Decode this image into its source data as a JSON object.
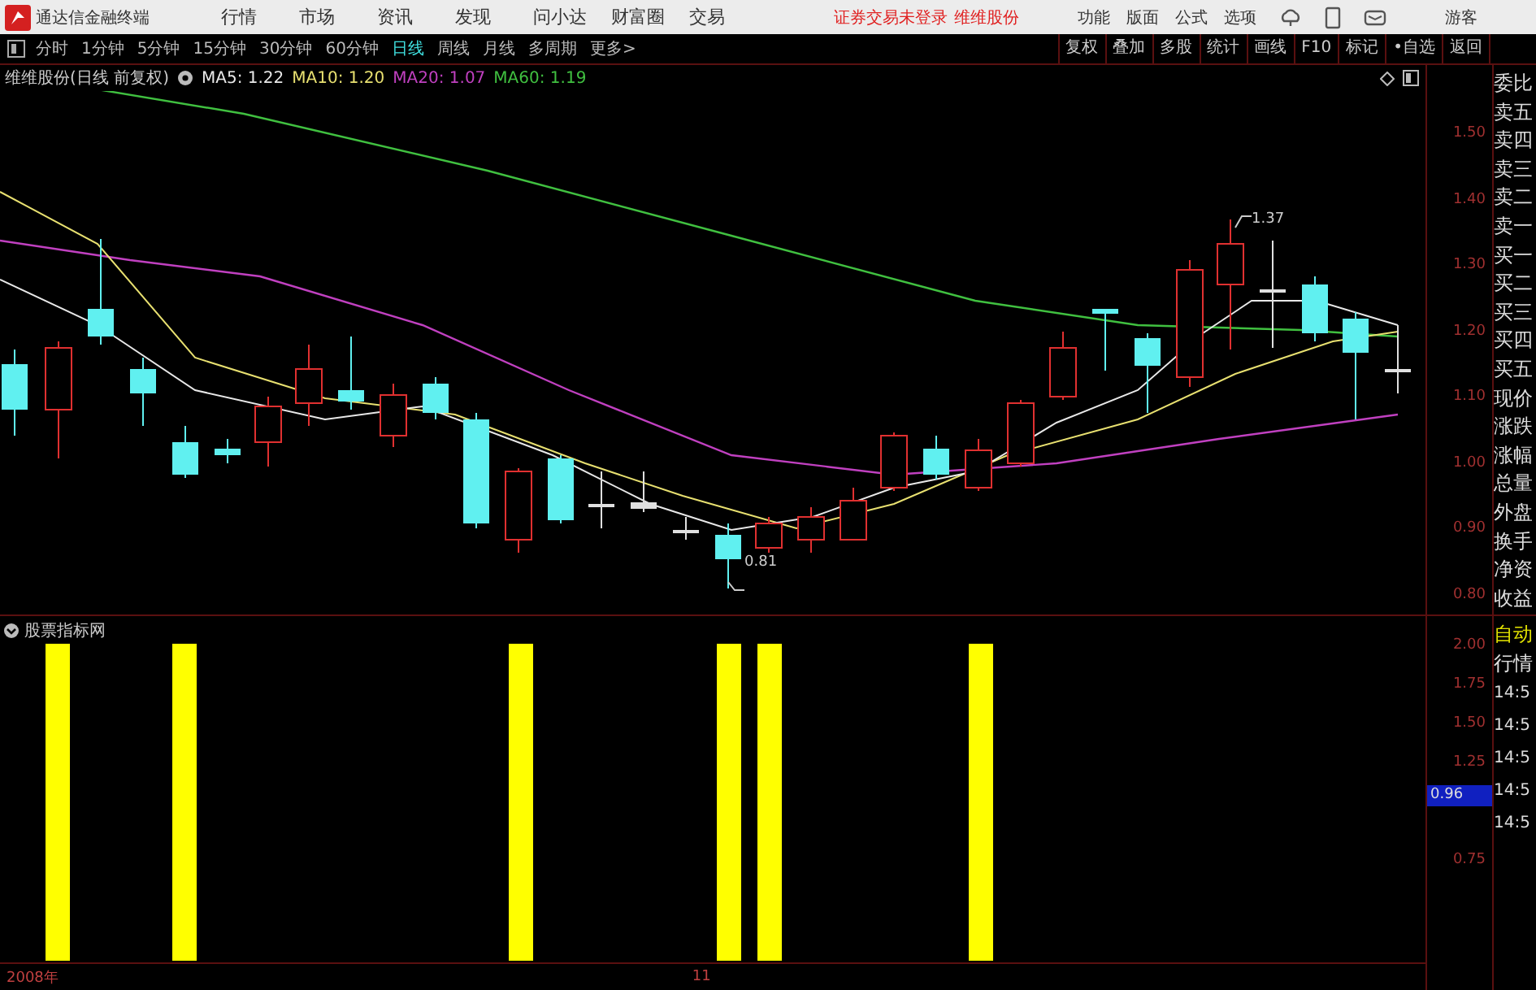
{
  "app": {
    "title": "通达信金融终端",
    "menu": [
      "行情",
      "市场",
      "资讯",
      "发现",
      "问小达",
      "财富圈",
      "交易"
    ],
    "login_status": "证券交易未登录",
    "stock_name": "维维股份",
    "function_menu": [
      "功能",
      "版面",
      "公式",
      "选项"
    ],
    "user": "游客"
  },
  "toolbar": {
    "periods": [
      {
        "label": "分时",
        "selected": false
      },
      {
        "label": "1分钟",
        "selected": false
      },
      {
        "label": "5分钟",
        "selected": false
      },
      {
        "label": "15分钟",
        "selected": false
      },
      {
        "label": "30分钟",
        "selected": false
      },
      {
        "label": "60分钟",
        "selected": false
      },
      {
        "label": "日线",
        "selected": true
      },
      {
        "label": "周线",
        "selected": false
      },
      {
        "label": "月线",
        "selected": false
      },
      {
        "label": "多周期",
        "selected": false
      },
      {
        "label": "更多>",
        "selected": false
      }
    ],
    "actions": [
      "复权",
      "叠加",
      "多股",
      "统计",
      "画线",
      "F10",
      "标记",
      "•自选",
      "返回"
    ]
  },
  "chart": {
    "title": "维维股份(日线 前复权)",
    "ma": [
      {
        "label": "MA5: 1.22",
        "color": "#e8e8e8"
      },
      {
        "label": "MA10: 1.20",
        "color": "#e8e070"
      },
      {
        "label": "MA20: 1.07",
        "color": "#c040c0"
      },
      {
        "label": "MA60: 1.19",
        "color": "#40c040"
      }
    ],
    "price_axis": [
      "1.50",
      "1.40",
      "1.30",
      "1.20",
      "1.10",
      "1.00",
      "0.90",
      "0.80"
    ],
    "high_label": "1.37",
    "low_label": "0.81"
  },
  "indicator": {
    "title": "股票指标网",
    "axis": [
      "2.00",
      "1.75",
      "1.50",
      "1.25",
      "0.75"
    ],
    "cursor_value": "0.96"
  },
  "date_axis": [
    "2008年",
    "11"
  ],
  "quote_panel": {
    "fields": [
      "委比",
      "卖五",
      "卖四",
      "卖三",
      "卖二",
      "卖一",
      "买一",
      "买二",
      "买三",
      "买四",
      "买五",
      "现价",
      "涨跌",
      "涨幅",
      "总量",
      "外盘",
      "换手",
      "净资",
      "收益"
    ],
    "header": [
      {
        "label": "自动",
        "color": "#e0e000"
      },
      {
        "label": "行情",
        "color": "#e0e0e0"
      }
    ],
    "times": [
      "14:5",
      "14:5",
      "14:5",
      "14:5",
      "14:5"
    ]
  }
}
